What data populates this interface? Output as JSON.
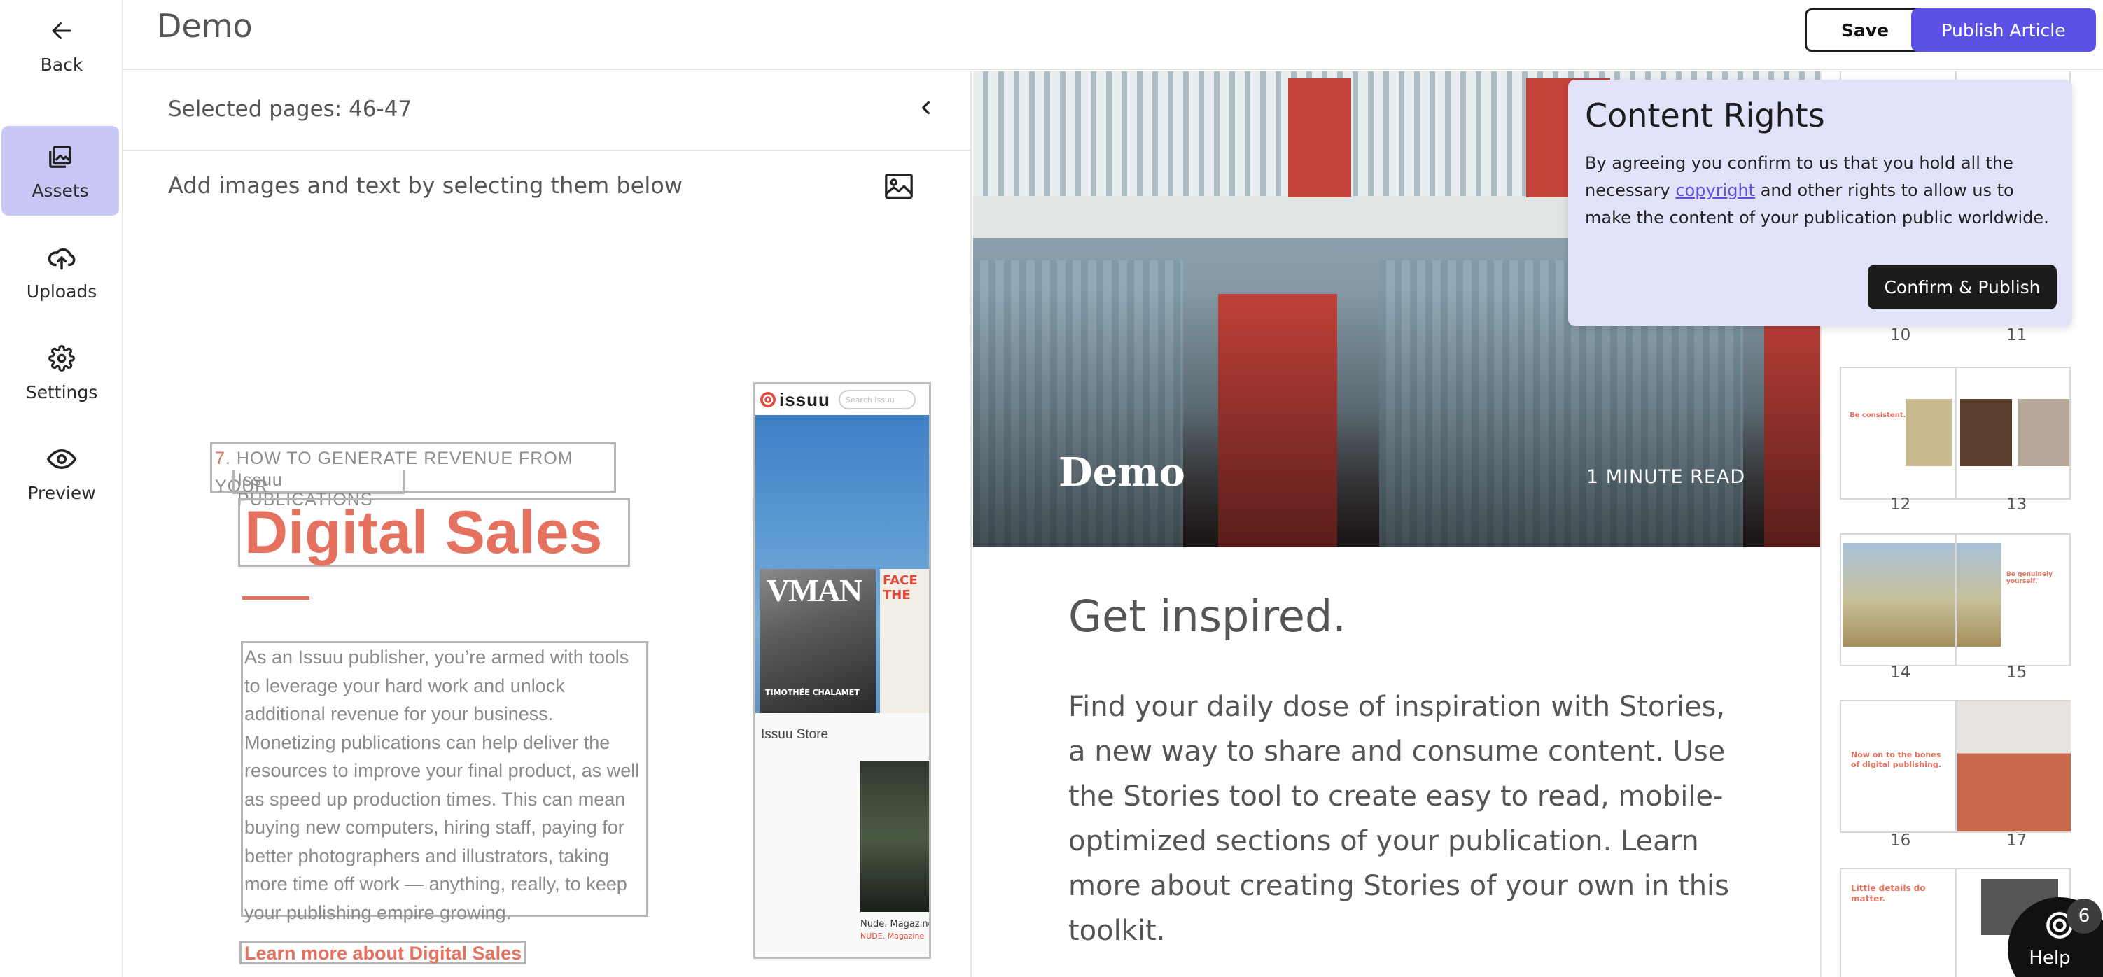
{
  "rail": {
    "back": "Back",
    "assets": "Assets",
    "uploads": "Uploads",
    "settings": "Settings",
    "preview": "Preview"
  },
  "header": {
    "title": "Demo",
    "save_label": "Save",
    "publish_label": "Publish Article"
  },
  "assets": {
    "selected_pages": "Selected pages: 46-47",
    "hint": "Add images and text by selecting them below",
    "page": {
      "toc_number": "7.",
      "toc_line1": "HOW TO GENERATE REVENUE FROM YOUR",
      "toc_line2": "Issuu PUBLICATIONS",
      "title": "Digital Sales",
      "body": "As an Issuu publisher, you’re armed with tools to leverage your hard work and unlock additional revenue for your business. Monetizing publications can help deliver the resources to improve your final product, as well as speed up production times. This can mean buying new computers, hiring staff, paying for better photographers and illustrators, taking more time off work — anything, really, to keep your publishing empire growing.",
      "link": "Learn more about Digital Sales"
    },
    "issuu_mock": {
      "logo": "issuu",
      "search_placeholder": "Search Issuu",
      "vman_logo": "VMAN",
      "vman_cover_line": "TIMOTHÉE CHALAMET",
      "face_line": "FACE THE",
      "store_label": "Issuu Store",
      "nude_title": "Nude. Magazine",
      "nude_sub": "NUDE. Magazine"
    }
  },
  "article": {
    "hero_title": "Demo",
    "read_time": "1 MINUTE READ",
    "heading": "Get inspired.",
    "paragraph": "Find your daily dose of inspiration with Stories, a new way to share and consume content. Use the Stories tool to create easy to read, mobile-optimized sections of your publication. Learn more about creating Stories of your own in this toolkit."
  },
  "thumbnails": {
    "pages": [
      "10",
      "11",
      "12",
      "13",
      "14",
      "15",
      "16",
      "17"
    ],
    "text_be_consistent": "Be consistent.",
    "text_be_genuinely": "Be genuinely yourself.",
    "text_bones": "Now on to the bones of digital publishing.",
    "text_little": "Little details do matter."
  },
  "rights": {
    "title": "Content Rights",
    "body_before": "By agreeing you confirm to us that you hold all the necessary ",
    "link": "copyright",
    "body_after": " and other rights to allow us to make the content of your publication public worldwide.",
    "confirm_label": "Confirm & Publish"
  },
  "help": {
    "label": "Help",
    "badge": "6"
  },
  "colors": {
    "accent": "#5b52e5",
    "active_rail": "#c9c7f6",
    "popover": "#e3e2fb",
    "issuu_coral": "#e5725f"
  }
}
